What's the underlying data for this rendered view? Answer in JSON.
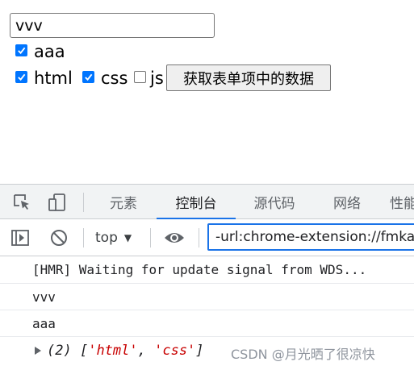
{
  "page": {
    "text_input_value": "vvv",
    "checkbox_aaa": {
      "label": "aaa",
      "checked": true
    },
    "checkbox_html": {
      "label": "html",
      "checked": true
    },
    "checkbox_css": {
      "label": "css",
      "checked": true
    },
    "checkbox_js": {
      "label": "js",
      "checked": false
    },
    "get_data_button": "获取表单项中的数据"
  },
  "devtools": {
    "icons": [
      "inspect-element-icon",
      "device-toolbar-icon"
    ],
    "tabs": [
      {
        "label": "元素",
        "active": false
      },
      {
        "label": "控制台",
        "active": true
      },
      {
        "label": "源代码",
        "active": false
      },
      {
        "label": "网络",
        "active": false
      },
      {
        "label": "性能",
        "active": false
      }
    ],
    "toolbar": {
      "sidebar_icon": "sidebar-toggle-icon",
      "clear_icon": "clear-console-icon",
      "context": "top",
      "eye_icon": "live-expression-icon",
      "filter_value": "-url:chrome-extension://fmkadmapgofadopljbjfkapdkoienihi"
    },
    "console": {
      "lines": [
        "[HMR] Waiting for update signal from WDS...",
        "vvv",
        "aaa"
      ],
      "array_summary": {
        "count": "(2)",
        "items": [
          "'html'",
          "'css'"
        ]
      }
    },
    "watermark": "CSDN @月光晒了很凉快"
  },
  "colors": {
    "accent": "#1a73e8",
    "checkbox": "#0075ff",
    "string": "#c80000"
  }
}
